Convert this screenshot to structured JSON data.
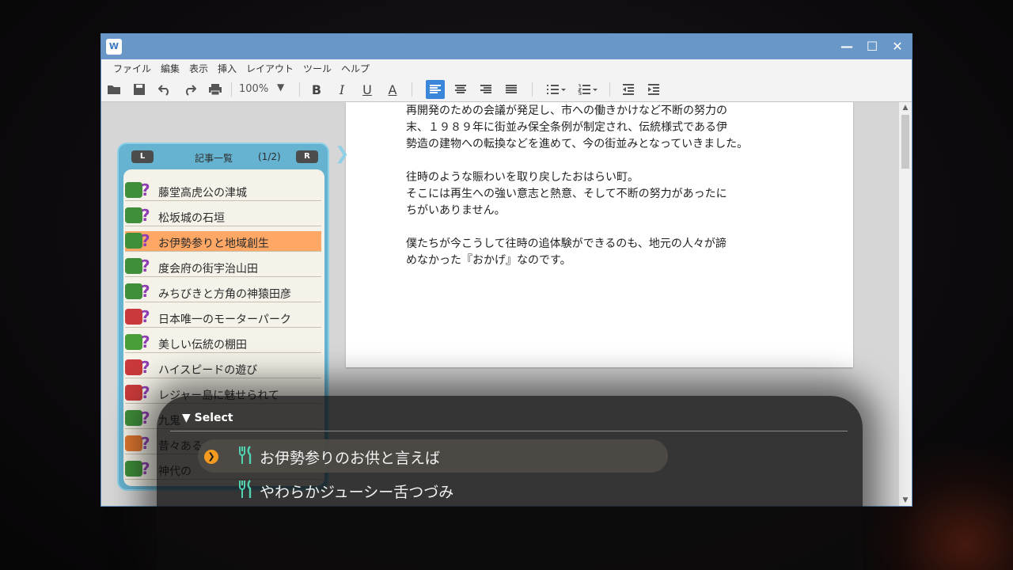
{
  "window": {
    "app_icon": "W",
    "controls": {
      "minimize": "—",
      "maximize": "☐",
      "close": "✕"
    }
  },
  "menu": [
    "ファイル",
    "編集",
    "表示",
    "挿入",
    "レイアウト",
    "ツール",
    "ヘルプ"
  ],
  "toolbar": {
    "zoom": "100%",
    "zoom_caret": "▼",
    "bold": "B",
    "italic": "I",
    "underline": "U",
    "font_color": "A"
  },
  "document": {
    "lines": [
      "再開発のための会議が発足し、市への働きかけなど不断の努力の",
      "末、１９８９年に街並み保全条例が制定され、伝統様式である伊",
      "勢造の建物への転換などを進めて、今の街並みとなっていきました。",
      "",
      "往時のような賑わいを取り戻したおはらい町。",
      "そこには再生への強い意志と熱意、そして不断の努力があったに",
      "ちがいありません。",
      "",
      "僕たちが今こうして往時の追体験ができるのも、地元の人々が諦",
      "めなかった『おかげ』なのです。"
    ]
  },
  "article_panel": {
    "left_button": "L",
    "right_button": "R",
    "title": "記事一覧",
    "page": "(1/2)",
    "question_mark": "?",
    "items": [
      {
        "label": "藤堂高虎公の津城",
        "icon": "castle-icon",
        "color": "#3f8f3a"
      },
      {
        "label": "松坂城の石垣",
        "icon": "castle-icon",
        "color": "#3f8f3a"
      },
      {
        "label": "お伊勢参りと地域創生",
        "icon": "castle-icon",
        "color": "#3f8f3a",
        "selected": true
      },
      {
        "label": "度会府の街宇治山田",
        "icon": "castle-icon",
        "color": "#3f8f3a"
      },
      {
        "label": "みちびきと方角の神猿田彦",
        "icon": "castle-icon",
        "color": "#3f8f3a"
      },
      {
        "label": "日本唯一のモーターパーク",
        "icon": "gamepad-icon",
        "color": "#c93a3a"
      },
      {
        "label": "美しい伝統の棚田",
        "icon": "tree-icon",
        "color": "#4a9e3a"
      },
      {
        "label": "ハイスピードの遊び",
        "icon": "gamepad-icon",
        "color": "#c93a3a"
      },
      {
        "label": "レジャー島に魅せられて",
        "icon": "gamepad-icon",
        "color": "#c93a3a"
      },
      {
        "label": "九鬼",
        "icon": "castle-icon",
        "color": "#3f8f3a"
      },
      {
        "label": "昔々ある",
        "icon": "person-icon",
        "color": "#e0762e"
      },
      {
        "label": "神代の",
        "icon": "castle-icon",
        "color": "#3f8f3a"
      }
    ]
  },
  "choices": {
    "header": "▼ Select",
    "cursor": "❯",
    "icon": "🍴",
    "options": [
      {
        "text": "お伊勢参りのお供と言えば",
        "highlighted": true
      },
      {
        "text": "やわらかジューシー舌つづみ",
        "highlighted": false
      }
    ]
  }
}
